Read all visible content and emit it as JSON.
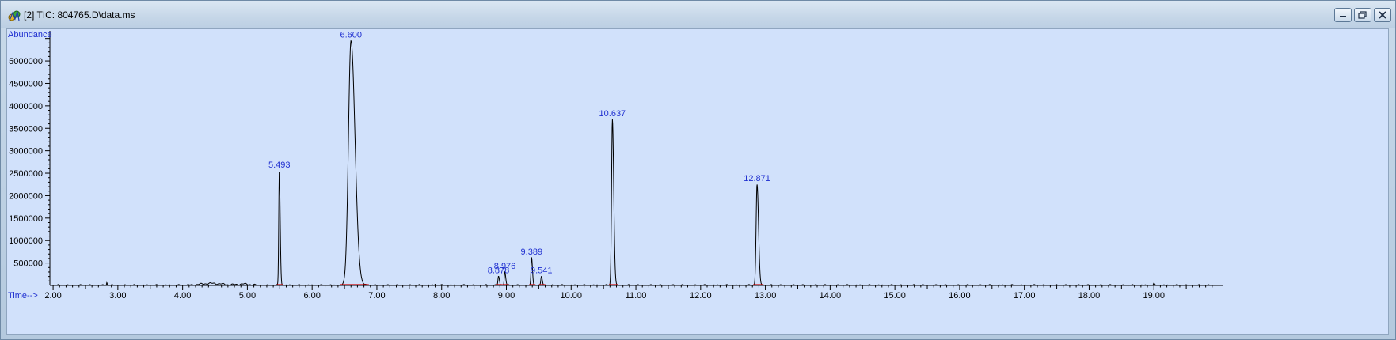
{
  "window": {
    "title": "[2] TIC: 804765.D\\data.ms",
    "controls": [
      {
        "name": "minimize",
        "icon": "minimize-icon"
      },
      {
        "name": "restore",
        "icon": "restore-icon"
      },
      {
        "name": "close",
        "icon": "close-icon"
      }
    ],
    "app_icon": "chromatogram-app-icon"
  },
  "chart_data": {
    "type": "line",
    "ylabel": "Abundance",
    "xlabel": "Time-->",
    "xlim": [
      1.95,
      20.0
    ],
    "ylim": [
      0,
      5600000
    ],
    "y_ticks": [
      500000,
      1000000,
      1500000,
      2000000,
      2500000,
      3000000,
      3500000,
      4000000,
      4500000,
      5000000
    ],
    "y_tick_labels": [
      "500000",
      "1000000",
      "1500000",
      "2000000",
      "2500000",
      "3000000",
      "3500000",
      "4000000",
      "4500000",
      "5000000"
    ],
    "x_ticks": [
      2,
      3,
      4,
      5,
      6,
      7,
      8,
      9,
      10,
      11,
      12,
      13,
      14,
      15,
      16,
      17,
      18,
      19
    ],
    "x_tick_labels": [
      "2.00",
      "3.00",
      "4.00",
      "5.00",
      "6.00",
      "7.00",
      "8.00",
      "9.00",
      "10.00",
      "11.00",
      "12.00",
      "13.00",
      "14.00",
      "15.00",
      "16.00",
      "17.00",
      "18.00",
      "19.00"
    ],
    "peaks": [
      {
        "rt": 5.493,
        "label": "5.493",
        "height": 2550000,
        "width": 0.012
      },
      {
        "rt": 6.6,
        "label": "6.600",
        "height": 5450000,
        "width": 0.055
      },
      {
        "rt": 8.878,
        "label": "8.878",
        "height": 200000,
        "width": 0.012
      },
      {
        "rt": 8.976,
        "label": "8.976",
        "height": 300000,
        "width": 0.012
      },
      {
        "rt": 9.389,
        "label": "9.389",
        "height": 620000,
        "width": 0.012
      },
      {
        "rt": 9.541,
        "label": "9.541",
        "height": 200000,
        "width": 0.012
      },
      {
        "rt": 10.637,
        "label": "10.637",
        "height": 3700000,
        "width": 0.018
      },
      {
        "rt": 12.871,
        "label": "12.871",
        "height": 2250000,
        "width": 0.02
      }
    ],
    "line_color": "#000000",
    "baseline_color": "#cc0000",
    "label_color": "#1f2fd0",
    "background": "#d1e1fb"
  }
}
